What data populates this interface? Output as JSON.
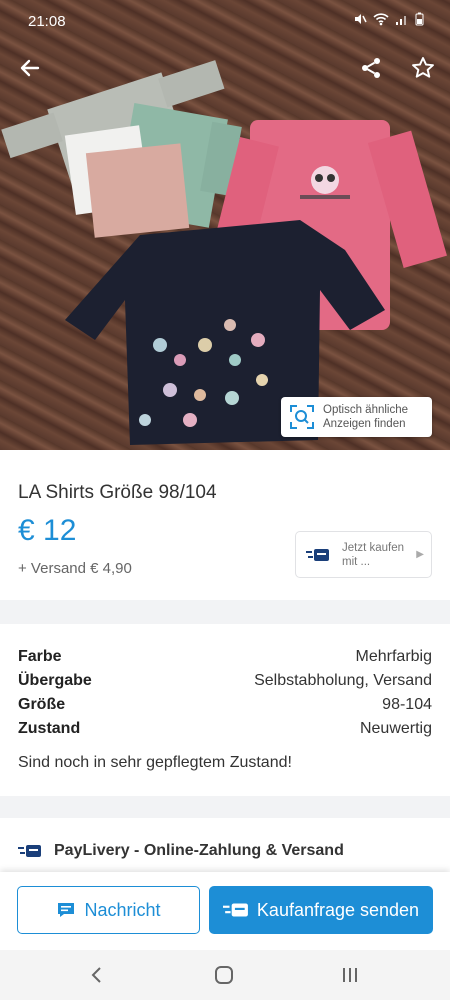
{
  "status_bar": {
    "time": "21:08"
  },
  "header": {
    "back_icon": "arrow-left-icon",
    "share_icon": "share-icon",
    "favorite_icon": "star-outline-icon"
  },
  "visual_search": {
    "label": "Optisch ähnliche Anzeigen finden"
  },
  "listing": {
    "title": "LA Shirts Größe 98/104",
    "price": "€ 12",
    "shipping": "+ Versand € 4,90",
    "buy_now_label": "Jetzt kaufen mit ..."
  },
  "details": {
    "attributes": [
      {
        "key": "Farbe",
        "value": "Mehrfarbig"
      },
      {
        "key": "Übergabe",
        "value": "Selbstabholung, Versand"
      },
      {
        "key": "Größe",
        "value": "98-104"
      },
      {
        "key": "Zustand",
        "value": "Neuwertig"
      }
    ],
    "description": "Sind noch in sehr gepflegtem Zustand!"
  },
  "paylivery": {
    "label": "PayLivery - Online-Zahlung & Versand"
  },
  "actions": {
    "message_label": "Nachricht",
    "buy_request_label": "Kaufanfrage senden"
  },
  "colors": {
    "accent": "#1d8ed6",
    "accent_dark": "#1a3f7a"
  }
}
